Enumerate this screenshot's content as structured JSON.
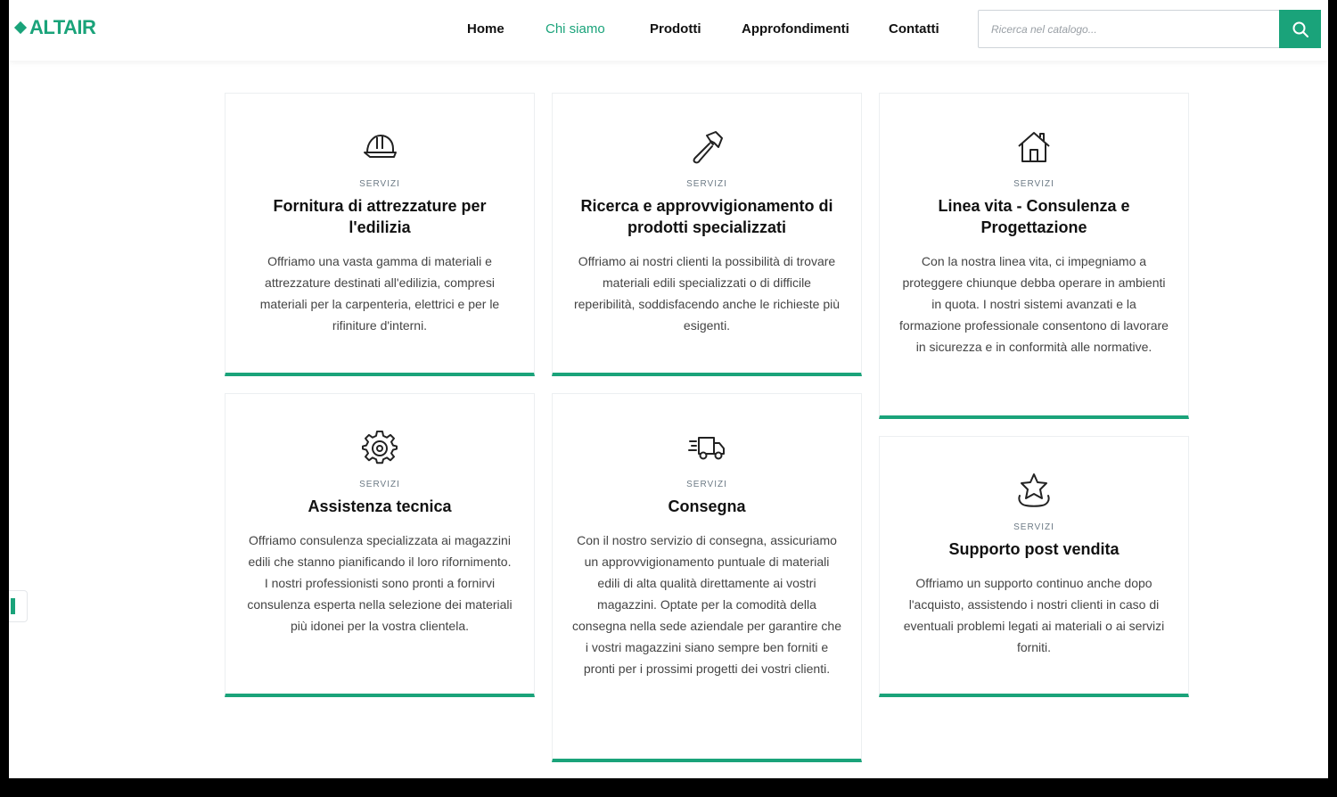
{
  "brand": {
    "name": "ALTAIR",
    "accent": "#1aa37a"
  },
  "nav": {
    "items": [
      {
        "label": "Home",
        "active": false
      },
      {
        "label": "Chi siamo",
        "active": true
      },
      {
        "label": "Prodotti",
        "active": false
      },
      {
        "label": "Approfondimenti",
        "active": false
      },
      {
        "label": "Contatti",
        "active": false
      }
    ]
  },
  "search": {
    "placeholder": "Ricerca nel catalogo...",
    "icon": "search-icon"
  },
  "cards": [
    {
      "icon": "helmet-icon",
      "kicker": "SERVIZI",
      "title": "Fornitura di attrezzature per l'edilizia",
      "text": "Offriamo una vasta gamma di materiali e attrezzature destinati all'edilizia, compresi materiali per la carpenteria, elettrici e per le rifiniture d'interni."
    },
    {
      "icon": "hammer-icon",
      "kicker": "SERVIZI",
      "title": "Ricerca e approvvigionamento di prodotti specializzati",
      "text": "Offriamo ai nostri clienti la possibilità di trovare materiali edili specializzati o di difficile reperibilità, soddisfacendo anche le richieste più esigenti."
    },
    {
      "icon": "house-icon",
      "kicker": "SERVIZI",
      "title": "Linea vita - Consulenza e Progettazione",
      "text": "Con la nostra linea vita, ci impegniamo a proteggere chiunque debba operare in ambienti in quota. I nostri sistemi avanzati e la formazione professionale consentono di lavorare in sicurezza e in conformità alle normative."
    },
    {
      "icon": "gear-icon",
      "kicker": "SERVIZI",
      "title": "Assistenza tecnica",
      "text": "Offriamo consulenza specializzata ai magazzini edili che stanno pianificando il loro rifornimento. I nostri professionisti sono pronti a fornirvi consulenza esperta nella selezione dei materiali più idonei per la vostra clientela."
    },
    {
      "icon": "delivery-truck-icon",
      "kicker": "SERVIZI",
      "title": "Consegna",
      "text": "Con il nostro servizio di consegna, assicuriamo un approvvigionamento puntuale di materiali edili di alta qualità direttamente ai vostri magazzini. Optate per la comodità della consegna nella sede aziendale per garantire che i vostri magazzini siano sempre ben forniti e pronti per i prossimi progetti dei vostri clienti."
    },
    {
      "icon": "support-star-icon",
      "kicker": "SERVIZI",
      "title": "Supporto post vendita",
      "text": "Offriamo un supporto continuo anche dopo l'acquisto, assistendo i nostri clienti in caso di eventuali problemi legati ai materiali o ai servizi forniti."
    }
  ]
}
